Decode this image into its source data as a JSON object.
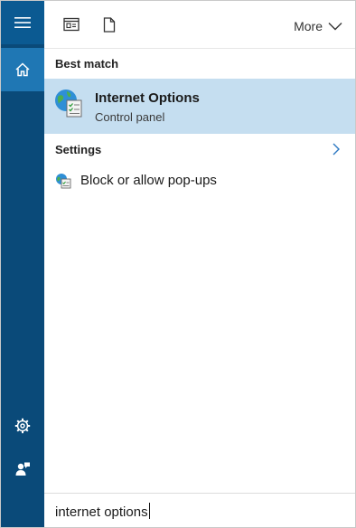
{
  "topbar": {
    "more_label": "More",
    "icons": [
      "apps-icon",
      "documents-icon",
      "chevron-down-icon"
    ]
  },
  "rail": {
    "icons": [
      "hamburger-menu-icon",
      "home-icon",
      "gear-icon",
      "feedback-icon"
    ]
  },
  "best_match": {
    "section_label": "Best match",
    "title": "Internet Options",
    "subtitle": "Control panel",
    "icon": "internet-options-icon"
  },
  "settings": {
    "section_label": "Settings",
    "items": [
      {
        "label": "Block or allow pop-ups",
        "icon": "popup-settings-icon"
      }
    ]
  },
  "search": {
    "query": "internet options"
  },
  "colors": {
    "rail": "#0a4a79",
    "rail_selected": "#1f77b4",
    "highlight": "#c5def0"
  }
}
